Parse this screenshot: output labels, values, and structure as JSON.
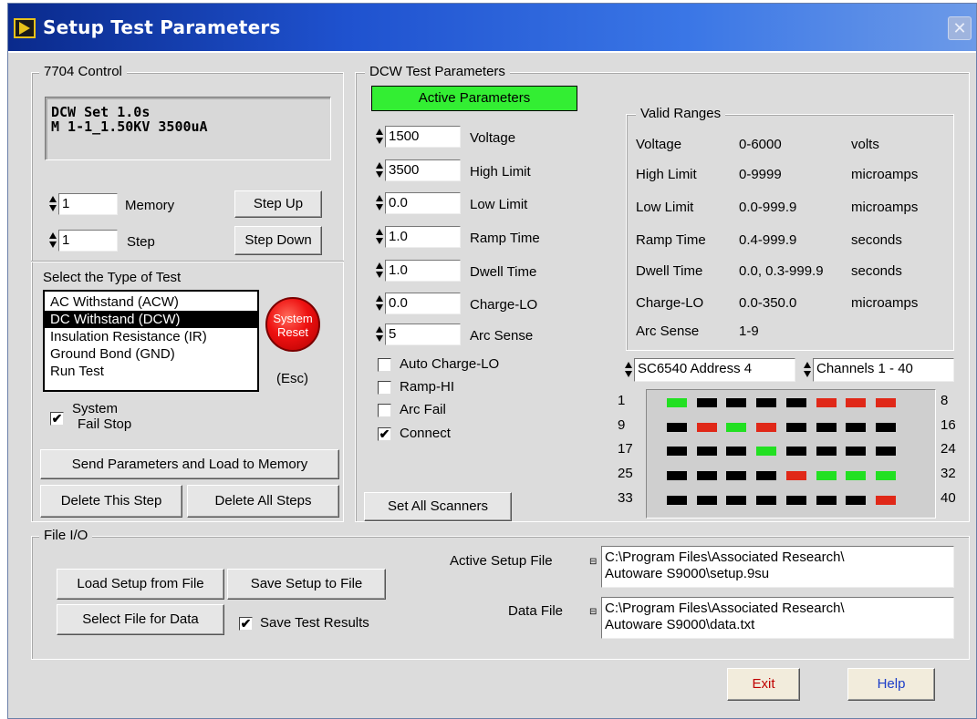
{
  "window": {
    "title": "Setup Test Parameters",
    "close_symbol": "✕"
  },
  "control": {
    "group_title": "7704 Control",
    "display_line1": "DCW Set 1.0s",
    "display_line2": "M  1-1_1.50KV 3500uA",
    "memory_value": "1",
    "memory_label": "Memory",
    "step_value": "1",
    "step_label": "Step",
    "step_up": "Step Up",
    "step_down": "Step Down",
    "select_type_label": "Select the Type of Test",
    "test_types": [
      "AC Withstand (ACW)",
      "DC Withstand (DCW)",
      "Insulation Resistance (IR)",
      "Ground Bond (GND)",
      "Run Test"
    ],
    "selected_test_index": 1,
    "reset_line1": "System",
    "reset_line2": "Reset",
    "esc_label": "(Esc)",
    "fail_stop_line1": "System",
    "fail_stop_line2": "Fail Stop",
    "fail_stop_checked": "✔",
    "send_button": "Send Parameters and Load to Memory",
    "delete_step": "Delete This Step",
    "delete_all": "Delete All Steps"
  },
  "dcw": {
    "group_title": "DCW Test Parameters",
    "active_label": "Active Parameters",
    "params": [
      {
        "value": "1500",
        "label": "Voltage"
      },
      {
        "value": "3500",
        "label": "High Limit"
      },
      {
        "value": "0.0",
        "label": "Low Limit"
      },
      {
        "value": "1.0",
        "label": "Ramp Time"
      },
      {
        "value": "1.0",
        "label": "Dwell Time"
      },
      {
        "value": "0.0",
        "label": "Charge-LO"
      },
      {
        "value": "5",
        "label": "Arc Sense"
      }
    ],
    "checks": [
      {
        "label": "Auto Charge-LO",
        "mark": ""
      },
      {
        "label": "Ramp-HI",
        "mark": ""
      },
      {
        "label": "Arc Fail",
        "mark": ""
      },
      {
        "label": "Connect",
        "mark": "✔"
      }
    ],
    "set_all_scanners": "Set All Scanners"
  },
  "ranges": {
    "group_title": "Valid Ranges",
    "rows": [
      {
        "name": "Voltage",
        "range": "0-6000",
        "unit": "volts"
      },
      {
        "name": "High Limit",
        "range": "0-9999",
        "unit": "microamps"
      },
      {
        "name": "Low Limit",
        "range": "0.0-999.9",
        "unit": "microamps"
      },
      {
        "name": "Ramp Time",
        "range": "0.4-999.9",
        "unit": "seconds"
      },
      {
        "name": "Dwell Time",
        "range": "0.0, 0.3-999.9",
        "unit": "seconds"
      },
      {
        "name": "Charge-LO",
        "range": "0.0-350.0",
        "unit": "microamps"
      },
      {
        "name": "Arc Sense",
        "range": "1-9",
        "unit": ""
      }
    ]
  },
  "scanner": {
    "address": "SC6540  Address 4",
    "channels": "Channels 1 - 40",
    "row_start_labels": [
      "1",
      "9",
      "17",
      "25",
      "33"
    ],
    "row_end_labels": [
      "8",
      "16",
      "24",
      "32",
      "40"
    ],
    "channel_states": [
      "green",
      "black",
      "black",
      "black",
      "black",
      "red",
      "red",
      "red",
      "black",
      "red",
      "green",
      "red",
      "black",
      "black",
      "black",
      "black",
      "black",
      "black",
      "black",
      "green",
      "black",
      "black",
      "black",
      "black",
      "black",
      "black",
      "black",
      "black",
      "red",
      "green",
      "green",
      "green",
      "black",
      "black",
      "black",
      "black",
      "black",
      "black",
      "black",
      "red"
    ],
    "colors": {
      "green": "#22e022",
      "red": "#e02818",
      "black": "#000000"
    }
  },
  "fileio": {
    "group_title": "File I/O",
    "load_setup": "Load Setup from File",
    "save_setup": "Save Setup to File",
    "select_data": "Select File for Data",
    "save_results": "Save Test Results",
    "save_results_checked": "✔",
    "active_setup_label": "Active Setup File",
    "active_setup_line1": "C:\\Program Files\\Associated Research\\",
    "active_setup_line2": "Autoware S9000\\setup.9su",
    "data_file_label": "Data File",
    "data_file_line1": "C:\\Program Files\\Associated Research\\",
    "data_file_line2": "Autoware S9000\\data.txt"
  },
  "footer": {
    "exit": "Exit",
    "help": "Help",
    "exit_color": "#c00000",
    "help_color": "#1a3cc8"
  },
  "colors": {
    "active_green": "#33ee33",
    "reset_red": "#ee1111"
  }
}
